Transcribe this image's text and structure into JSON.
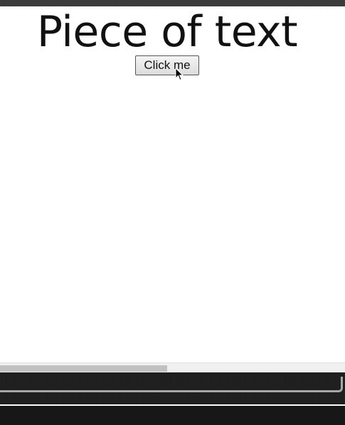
{
  "page": {
    "heading": "Piece of text",
    "button_label": "Click me"
  },
  "icons": {
    "cursor": "mouse-pointer-icon"
  },
  "scrollbar": {
    "horizontal_position": 0.0
  },
  "colors": {
    "heading_text": "#111111",
    "page_background": "#ffffff",
    "chrome_dark": "#1f1f1f"
  }
}
